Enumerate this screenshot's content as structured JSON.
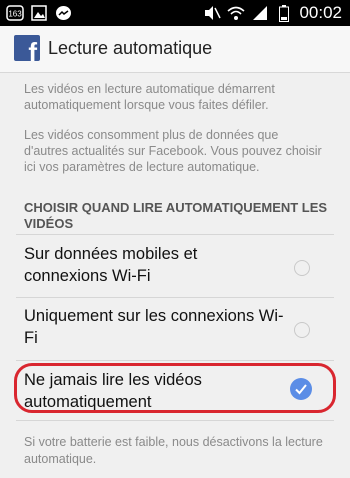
{
  "status_bar": {
    "notification_count": "163",
    "time": "00:02",
    "icons": [
      "notification-count-icon",
      "image-icon",
      "messenger-icon",
      "mute-icon",
      "wifi-icon",
      "signal-icon",
      "battery-icon"
    ]
  },
  "toolbar": {
    "logo_letter": "f",
    "title": "Lecture automatique"
  },
  "content": {
    "intro_1": "Les vidéos en lecture automatique démarrent automatiquement lorsque vous faites défiler.",
    "intro_2": "Les vidéos consomment plus de données que d'autres actualités sur Facebook. Vous pouvez choisir ici vos paramètres de lecture automatique.",
    "section_header": "CHOISIR QUAND LIRE AUTOMATIQUEMENT LES VIDÉOS",
    "options": [
      {
        "label": "Sur données mobiles et connexions Wi-Fi",
        "selected": false
      },
      {
        "label": "Uniquement sur les connexions Wi-Fi",
        "selected": false
      },
      {
        "label": "Ne jamais lire les vidéos automatiquement",
        "selected": true
      }
    ],
    "footer": "Si votre batterie est faible, nous désactivons la lecture automatique."
  },
  "colors": {
    "facebook_blue": "#3b5998",
    "radio_checked": "#5b8de6",
    "highlight_red": "#d9262f"
  }
}
